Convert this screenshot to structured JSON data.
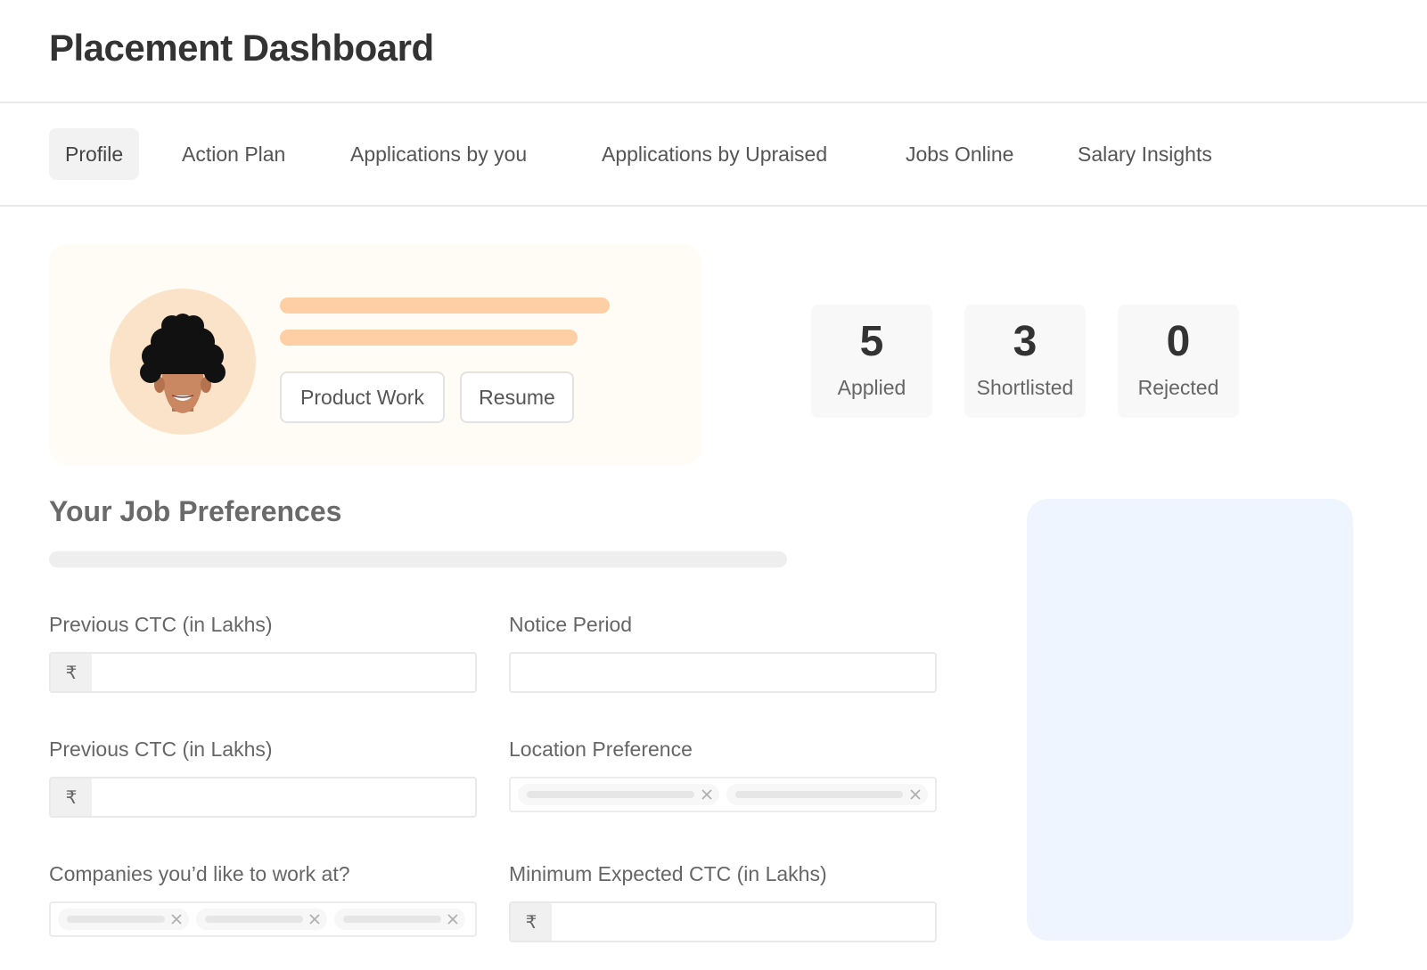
{
  "header": {
    "title": "Placement Dashboard"
  },
  "tabs": [
    {
      "label": "Profile",
      "active": true
    },
    {
      "label": "Action Plan",
      "active": false
    },
    {
      "label": "Applications by you",
      "active": false
    },
    {
      "label": "Applications by Upraised",
      "active": false
    },
    {
      "label": "Jobs Online",
      "active": false
    },
    {
      "label": "Salary Insights",
      "active": false
    }
  ],
  "profile": {
    "buttons": {
      "product_work": "Product Work",
      "resume": "Resume"
    }
  },
  "stats": [
    {
      "value": "5",
      "label": "Applied"
    },
    {
      "value": "3",
      "label": "Shortlisted"
    },
    {
      "value": "0",
      "label": "Rejected"
    }
  ],
  "preferences": {
    "title": "Your Job Preferences",
    "fields": {
      "previous_ctc_1": {
        "label": "Previous CTC (in Lakhs)",
        "prefix": "₹",
        "value": ""
      },
      "notice_period": {
        "label": "Notice Period",
        "value": ""
      },
      "previous_ctc_2": {
        "label": "Previous CTC (in Lakhs)",
        "prefix": "₹",
        "value": ""
      },
      "location_preference": {
        "label": "Location Preference",
        "tag_count": 2
      },
      "companies": {
        "label": "Companies you’d like to work at?",
        "tag_count": 3
      },
      "min_expected_ctc": {
        "label": "Minimum Expected CTC (in Lakhs)",
        "prefix": "₹",
        "value": ""
      }
    }
  },
  "colors": {
    "accent_bar": "#fecfa4",
    "card_bg": "#fffcf5",
    "panel_bg": "#eef5fe",
    "avatar_bg": "#fbe3c9"
  }
}
